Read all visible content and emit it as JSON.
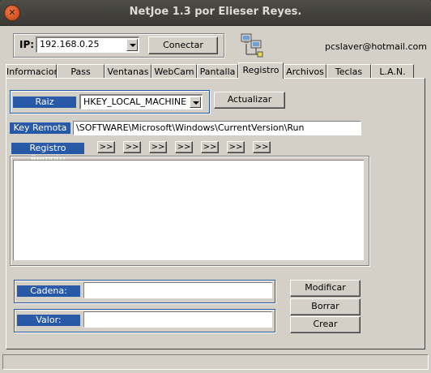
{
  "window": {
    "title": "NetJoe 1.3 por Elieser Reyes."
  },
  "connection": {
    "ip_label": "IP:",
    "ip_value": "192.168.0.25",
    "connect_label": "Conectar",
    "email": "pcslaver@hotmail.com"
  },
  "tabs": [
    "Informacion",
    "Pass",
    "Ventanas",
    "WebCam",
    "Pantalla",
    "Registro",
    "Archivos",
    "Teclas",
    "L.A.N."
  ],
  "active_tab": "Registro",
  "registry": {
    "raiz_label": "Raiz",
    "raiz_value": "HKEY_LOCAL_MACHINE",
    "update_label": "Actualizar",
    "key_label": "Key Remota",
    "key_value": "\\SOFTWARE\\Microsoft\\Windows\\CurrentVersion\\Run",
    "remote_label": "Registro Remoto",
    "nav_buttons": [
      ">>",
      ">>",
      ">>",
      ">>",
      ">>",
      ">>",
      ">>"
    ]
  },
  "form": {
    "cadena_label": "Cadena:",
    "cadena_value": "",
    "valor_label": "Valor:",
    "valor_value": "",
    "modify_label": "Modificar",
    "delete_label": "Borrar",
    "create_label": "Crear"
  }
}
